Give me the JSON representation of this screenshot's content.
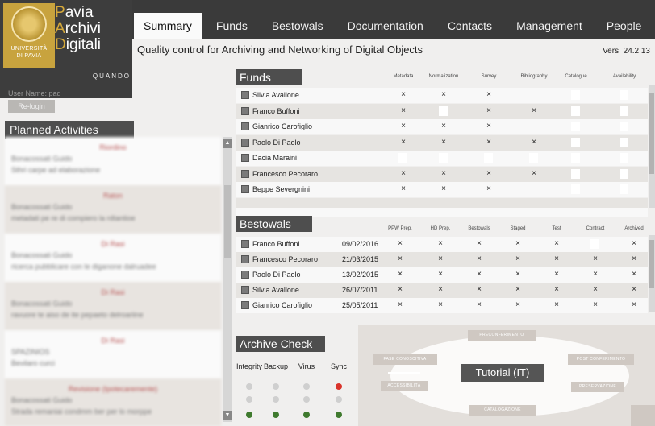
{
  "logo": {
    "line1": "Pavia",
    "line2": "Archivi",
    "line3": "Digitali",
    "tagline": "QUANDO",
    "seal_text_1": "UNIVERSITÀ",
    "seal_text_2": "DI PAVIA",
    "colors": {
      "gold": "#c8a33e",
      "dark": "#3d3d3d"
    }
  },
  "tabs": [
    "Summary",
    "Funds",
    "Bestowals",
    "Documentation",
    "Contacts",
    "Management",
    "People"
  ],
  "active_tab": "Summary",
  "subtitle": "Quality control for Archiving and Networking of Digital Objects",
  "version": "Vers. 24.2.13",
  "user": {
    "label": "User Name: pad",
    "relogin": "Re-login"
  },
  "planned": {
    "title": "Planned Activities",
    "items": [
      {
        "tag": "Riordino",
        "line1": "Bonacossati Guido",
        "line2": "Sthri carpe ad elaborazione"
      },
      {
        "tag": "Raton",
        "line1": "Bonacossati Guido",
        "line2": "metadati pe re di compiero la rdtantioe"
      },
      {
        "tag": "Di Rasi",
        "line1": "Bonacossati Guido",
        "line2": "ricerca pubblicare con le diganone dalruadee"
      },
      {
        "tag": "Di Rasi",
        "line1": "Bonacossati Guido",
        "line2": "ravuore te aiso de ite pepaeto delroariine"
      },
      {
        "tag": "Di Rasi",
        "line1": "SPAZINIOS",
        "line2": "Bevilaro curci"
      },
      {
        "tag": "Revisione (Ipotecaremente)",
        "line1": "Bonacossati Guido",
        "line2": "Strada remaniai condmm ber per lo morppe"
      }
    ]
  },
  "funds": {
    "title": "Funds",
    "columns": [
      "Metadata",
      "Normalization",
      "Survey",
      "Bibliography",
      "Catalogue",
      "Availability"
    ],
    "rows": [
      {
        "name": "Silvia Avallone",
        "cells": [
          "x",
          "x",
          "x",
          "",
          "box",
          "box"
        ]
      },
      {
        "name": "Franco Buffoni",
        "cells": [
          "x",
          "box",
          "x",
          "x",
          "box",
          "box"
        ]
      },
      {
        "name": "Gianrico Carofiglio",
        "cells": [
          "x",
          "x",
          "x",
          "",
          "box",
          "box"
        ]
      },
      {
        "name": "Paolo Di Paolo",
        "cells": [
          "x",
          "x",
          "x",
          "x",
          "box",
          "box"
        ]
      },
      {
        "name": "Dacia Maraini",
        "cells": [
          "box",
          "box",
          "box",
          "box",
          "box",
          "box"
        ]
      },
      {
        "name": "Francesco Pecoraro",
        "cells": [
          "x",
          "x",
          "x",
          "x",
          "box",
          "box"
        ]
      },
      {
        "name": "Beppe Severgnini",
        "cells": [
          "x",
          "x",
          "x",
          "",
          "box",
          "box"
        ]
      }
    ]
  },
  "bestowals": {
    "title": "Bestowals",
    "columns": [
      "PPW Prep.",
      "HD Prep.",
      "Bestowals",
      "Staged",
      "Test",
      "Contract",
      "Archived"
    ],
    "rows": [
      {
        "name": "Franco Buffoni",
        "date": "09/02/2016",
        "cells": [
          "x",
          "x",
          "x",
          "x",
          "x",
          "box",
          "x"
        ]
      },
      {
        "name": "Francesco Pecoraro",
        "date": "21/03/2015",
        "cells": [
          "x",
          "x",
          "x",
          "x",
          "x",
          "x",
          "x"
        ]
      },
      {
        "name": "Paolo Di Paolo",
        "date": "13/02/2015",
        "cells": [
          "x",
          "x",
          "x",
          "x",
          "x",
          "x",
          "x"
        ]
      },
      {
        "name": "Silvia Avallone",
        "date": "26/07/2011",
        "cells": [
          "x",
          "x",
          "x",
          "x",
          "x",
          "x",
          "x"
        ]
      },
      {
        "name": "Gianrico Carofiglio",
        "date": "25/05/2011",
        "cells": [
          "x",
          "x",
          "x",
          "x",
          "x",
          "x",
          "x"
        ]
      }
    ]
  },
  "archive_check": {
    "title": "Archive Check",
    "columns": [
      "Integrity",
      "Backup",
      "Virus",
      "Sync"
    ],
    "status_colors": {
      "grey": "#cfcfcf",
      "red": "#d9332b",
      "green": "#3f7a2e"
    },
    "rows": [
      [
        "grey",
        "grey",
        "grey",
        "red"
      ],
      [
        "grey",
        "grey",
        "grey",
        "grey"
      ],
      [
        "green",
        "green",
        "green",
        "green"
      ]
    ]
  },
  "tutorial": {
    "title": "Tutorial (IT)",
    "steps": [
      "PRECONFERIMENTO",
      "FASE CONOSCITIVA",
      "POST CONFERIMENTO",
      "ACCESSIBILITÀ",
      "PRESERVAZIONE",
      "CATALOGAZIONE"
    ]
  },
  "glyphs": {
    "check": "×",
    "scroll_up": "▲",
    "scroll_down": "▼"
  }
}
